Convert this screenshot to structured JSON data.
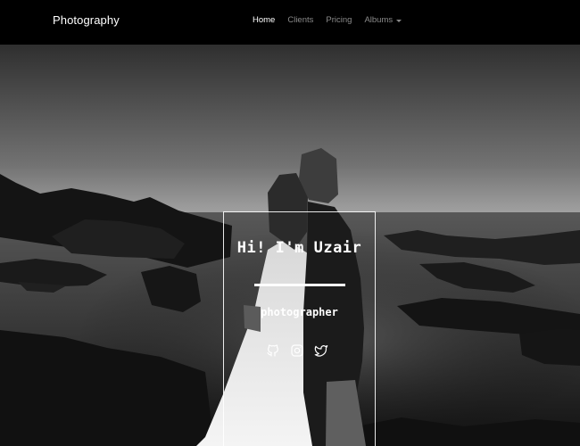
{
  "navbar": {
    "brand": "Photography",
    "links": [
      {
        "label": "Home",
        "active": true
      },
      {
        "label": "Clients",
        "active": false
      },
      {
        "label": "Pricing",
        "active": false
      },
      {
        "label": "Albums",
        "active": false,
        "dropdown": true
      }
    ]
  },
  "hero": {
    "title": "Hi! I'm Uzair",
    "subtitle": "photographer",
    "social_icons": [
      "github-icon",
      "instagram-icon",
      "twitter-icon"
    ]
  },
  "colors": {
    "navbar_bg": "#000000",
    "nav_active": "#ffffff",
    "nav_inactive": "#8a8a8a",
    "hero_text": "#ffffff"
  }
}
